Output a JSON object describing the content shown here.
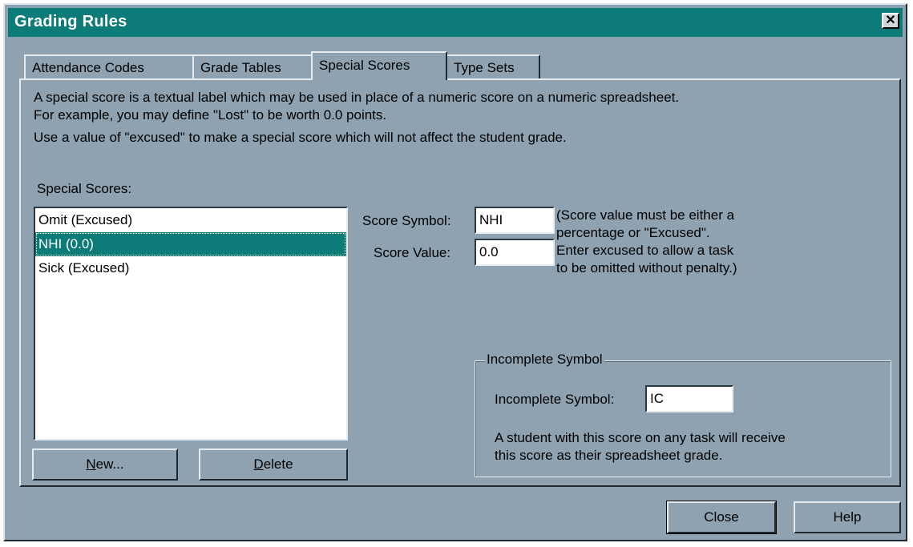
{
  "window": {
    "title": "Grading Rules",
    "close_glyph": "✕"
  },
  "tabs": [
    {
      "label": "Attendance Codes"
    },
    {
      "label": "Grade Tables"
    },
    {
      "label": "Special Scores"
    },
    {
      "label": "Type Sets"
    }
  ],
  "description": {
    "line1": "A special score is a textual label which may be used in place of a numeric score on a numeric spreadsheet.",
    "line2": "For example, you may define \"Lost\" to be worth 0.0 points.",
    "line3": "Use a value of \"excused\" to make a special score which will not affect the student grade."
  },
  "special_scores": {
    "label": "Special Scores:",
    "items": [
      {
        "label": "Omit (Excused)"
      },
      {
        "label": "NHI (0.0)"
      },
      {
        "label": "Sick (Excused)"
      }
    ],
    "selected_index": 1
  },
  "form": {
    "score_symbol_label": "Score Symbol:",
    "score_symbol_value": "NHI",
    "score_value_label": "Score Value:",
    "score_value_value": "0.0",
    "hint": {
      "line1": "(Score value must be either a",
      "line2": "percentage or \"Excused\".",
      "line3": "Enter excused to allow a task",
      "line4": "to be omitted without penalty.)"
    }
  },
  "incomplete": {
    "group_title": "Incomplete Symbol",
    "label": "Incomplete Symbol:",
    "value": "IC",
    "desc_line1": "A student with this score on any task will receive",
    "desc_line2": "this score as their spreadsheet grade."
  },
  "buttons": {
    "new_mnemonic": "N",
    "new_rest": "ew...",
    "delete_mnemonic": "D",
    "delete_rest": "elete",
    "close": "Close",
    "help": "Help"
  }
}
